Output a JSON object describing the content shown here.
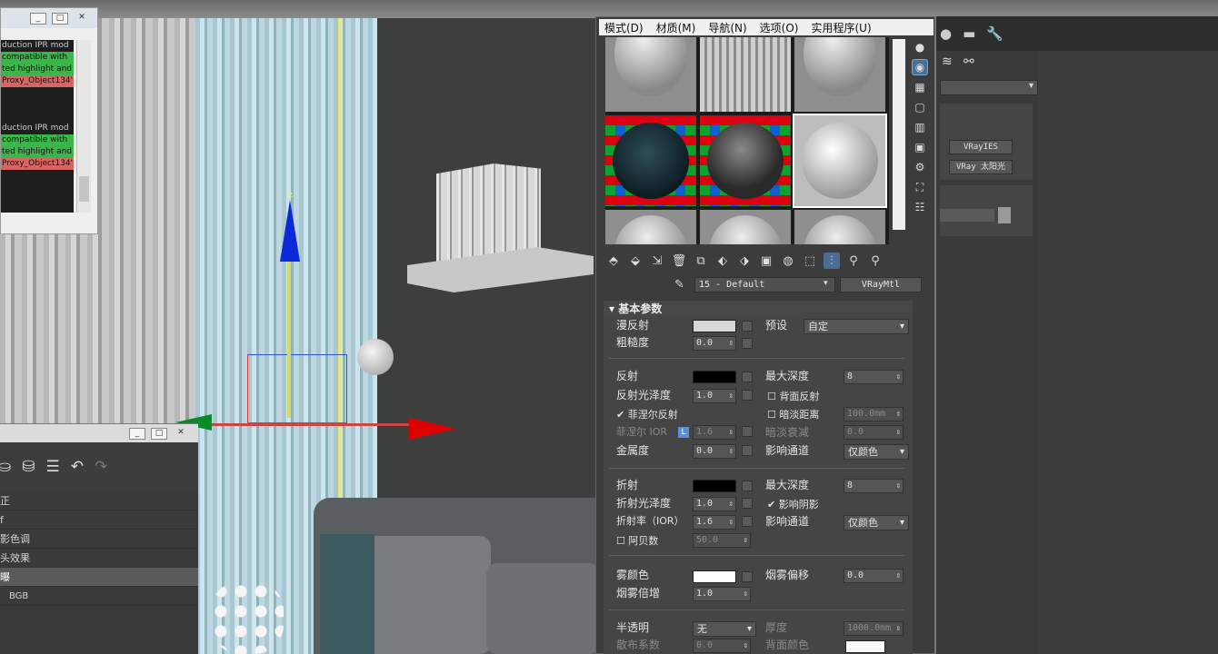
{
  "log": {
    "lines": [
      {
        "text": "duction IPR mod",
        "style": "normal"
      },
      {
        "text": "compatible with",
        "style": "green"
      },
      {
        "text": "ted highlight and",
        "style": "green"
      },
      {
        "text": "Proxy_Object134'",
        "style": "red"
      },
      {
        "text": "",
        "style": "normal"
      },
      {
        "text": "",
        "style": "normal"
      },
      {
        "text": "",
        "style": "normal"
      },
      {
        "text": "duction IPR mod",
        "style": "normal"
      },
      {
        "text": "compatible with",
        "style": "green"
      },
      {
        "text": "ted highlight and",
        "style": "green"
      },
      {
        "text": "Proxy_Object134'",
        "style": "red"
      }
    ]
  },
  "gizmo": {
    "z_label": "z"
  },
  "lower_panel": {
    "items": [
      "正",
      "f",
      "影色调",
      "头效果",
      "曝",
      "BGB"
    ],
    "selected_index": 4
  },
  "material_editor": {
    "menu": [
      "模式(D)",
      "材质(M)",
      "导航(N)",
      "选项(O)",
      "实用程序(U)"
    ],
    "material_name": "15 - Default",
    "material_type": "VRayMtl",
    "rollout_title": "基本参数",
    "params": {
      "diffuse": "漫反射",
      "roughness": "粗糙度",
      "roughness_val": "0.0",
      "preset": "预设",
      "preset_val": "自定",
      "reflect": "反射",
      "max_depth": "最大深度",
      "reflect_depth_val": "8",
      "reflect_gloss": "反射光泽度",
      "reflect_gloss_val": "1.0",
      "back_reflect": "背面反射",
      "fresnel": "菲涅尔反射",
      "dim_distance": "暗淡距离",
      "dim_distance_val": "100.0mm",
      "fresnel_ior": "菲涅尔 IOR",
      "fresnel_ior_val": "1.6",
      "fresnel_ior_lock": "L",
      "dim_falloff": "暗淡衰减",
      "dim_falloff_val": "0.0",
      "metalness": "金属度",
      "metalness_val": "0.0",
      "affect_channels": "影响通道",
      "affect_channels_val": "仅颜色",
      "refract": "折射",
      "refract_depth_val": "8",
      "refract_gloss": "折射光泽度",
      "refract_gloss_val": "1.0",
      "affect_shadows": "影响阴影",
      "ior": "折射率（IOR）",
      "ior_val": "1.6",
      "refract_channels_val": "仅颜色",
      "abbe": "阿贝数",
      "abbe_val": "50.0",
      "fog_color": "雾颜色",
      "fog_bias": "烟雾偏移",
      "fog_bias_val": "0.0",
      "fog_mult": "烟雾倍增",
      "fog_mult_val": "1.0",
      "translucency": "半透明",
      "translucency_val": "无",
      "thickness": "厚度",
      "thickness_val": "1000.0mm",
      "scatter": "散布系数",
      "scatter_val": "0.0",
      "back_color": "背面颜色"
    },
    "colors": {
      "diffuse": "#d8d8d8",
      "reflect": "#000000",
      "refract": "#000000",
      "fog": "#ffffff",
      "back": "#ffffff"
    }
  },
  "command_panel": {
    "buttons": [
      "VRayIES",
      "VRay 太阳光"
    ]
  }
}
